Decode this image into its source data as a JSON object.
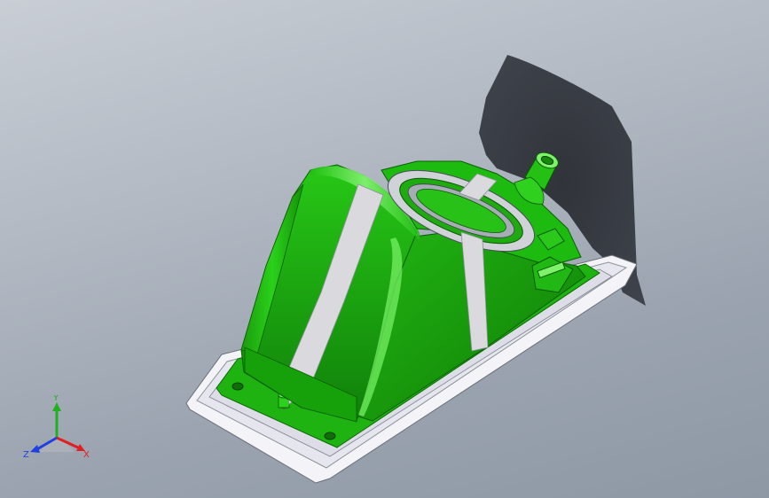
{
  "viewport": {
    "model_name": "",
    "colors": {
      "part_green": "#1fbf10",
      "part_green_dark": "#128a07",
      "part_green_light": "#6cf05a",
      "tape": "#d8d8dc",
      "flange": "#f2f2f6",
      "shadow": "#2a2d33"
    }
  },
  "triad": {
    "x_label": "X",
    "y_label": "Y",
    "z_label": "Z",
    "x_color": "#e02020",
    "y_color": "#20b020",
    "z_color": "#2040e0"
  }
}
